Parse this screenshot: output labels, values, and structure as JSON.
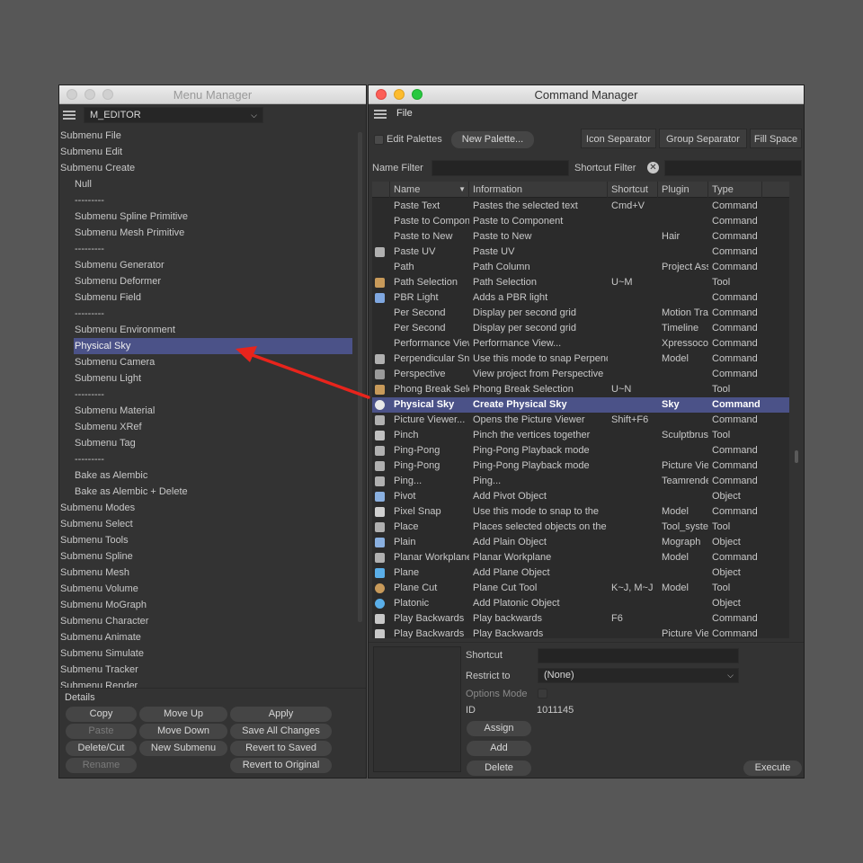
{
  "menu_manager": {
    "title": "Menu Manager",
    "menu_select": "M_EDITOR",
    "items": [
      {
        "label": "Submenu File",
        "indent": 0
      },
      {
        "label": "Submenu Edit",
        "indent": 0
      },
      {
        "label": "Submenu Create",
        "indent": 0
      },
      {
        "label": "Null",
        "indent": 1
      },
      {
        "label": "---------",
        "indent": 1
      },
      {
        "label": "Submenu Spline Primitive",
        "indent": 1
      },
      {
        "label": "Submenu Mesh Primitive",
        "indent": 1
      },
      {
        "label": "---------",
        "indent": 1
      },
      {
        "label": "Submenu Generator",
        "indent": 1
      },
      {
        "label": "Submenu Deformer",
        "indent": 1
      },
      {
        "label": "Submenu Field",
        "indent": 1
      },
      {
        "label": "---------",
        "indent": 1
      },
      {
        "label": "Submenu Environment",
        "indent": 1
      },
      {
        "label": "Physical Sky",
        "indent": 1,
        "selected": true
      },
      {
        "label": "Submenu Camera",
        "indent": 1
      },
      {
        "label": "Submenu Light",
        "indent": 1
      },
      {
        "label": "---------",
        "indent": 1
      },
      {
        "label": "Submenu Material",
        "indent": 1
      },
      {
        "label": "Submenu XRef",
        "indent": 1
      },
      {
        "label": "Submenu Tag",
        "indent": 1
      },
      {
        "label": "---------",
        "indent": 1
      },
      {
        "label": "Bake as Alembic",
        "indent": 1
      },
      {
        "label": "Bake as Alembic + Delete",
        "indent": 1
      },
      {
        "label": "Submenu Modes",
        "indent": 0
      },
      {
        "label": "Submenu Select",
        "indent": 0
      },
      {
        "label": "Submenu Tools",
        "indent": 0
      },
      {
        "label": "Submenu Spline",
        "indent": 0
      },
      {
        "label": "Submenu Mesh",
        "indent": 0
      },
      {
        "label": "Submenu Volume",
        "indent": 0
      },
      {
        "label": "Submenu MoGraph",
        "indent": 0
      },
      {
        "label": "Submenu Character",
        "indent": 0
      },
      {
        "label": "Submenu Animate",
        "indent": 0
      },
      {
        "label": "Submenu Simulate",
        "indent": 0
      },
      {
        "label": "Submenu Tracker",
        "indent": 0
      },
      {
        "label": "Submenu Render",
        "indent": 0
      }
    ],
    "details_label": "Details",
    "buttons": {
      "copy": "Copy",
      "move_up": "Move Up",
      "apply": "Apply",
      "paste": "Paste",
      "move_down": "Move Down",
      "save_all": "Save All Changes",
      "delete_cut": "Delete/Cut",
      "new_submenu": "New Submenu",
      "revert_saved": "Revert to Saved",
      "rename": "Rename",
      "revert_original": "Revert to Original"
    }
  },
  "command_manager": {
    "title": "Command Manager",
    "file_menu": "File",
    "edit_palettes": "Edit Palettes",
    "new_palette": "New Palette...",
    "icon_separator": "Icon Separator",
    "group_separator": "Group Separator",
    "fill_space": "Fill Space",
    "name_filter_label": "Name Filter",
    "name_filter_value": "",
    "shortcut_filter_label": "Shortcut Filter",
    "shortcut_filter_value": "",
    "columns": [
      "Name",
      "Information",
      "Shortcut",
      "Plugin",
      "Type"
    ],
    "rows": [
      {
        "icon": "none",
        "name": "Paste Text",
        "info": "Pastes the selected text",
        "shortcut": "Cmd+V",
        "plugin": "",
        "type": "Command"
      },
      {
        "icon": "none",
        "name": "Paste to Component",
        "info": "Paste to Component",
        "shortcut": "",
        "plugin": "",
        "type": "Command"
      },
      {
        "icon": "none",
        "name": "Paste to New",
        "info": "Paste to New",
        "shortcut": "",
        "plugin": "Hair",
        "type": "Command"
      },
      {
        "icon": "clipboard-icon",
        "name": "Paste UV",
        "info": "Paste UV",
        "shortcut": "",
        "plugin": "",
        "type": "Command"
      },
      {
        "icon": "none",
        "name": "Path",
        "info": "Path Column",
        "shortcut": "",
        "plugin": "Project Asset",
        "type": "Command"
      },
      {
        "icon": "path-selection-icon",
        "name": "Path Selection",
        "info": "Path Selection",
        "shortcut": "U~M",
        "plugin": "",
        "type": "Tool"
      },
      {
        "icon": "pbr-light-icon",
        "name": "PBR Light",
        "info": "Adds a PBR light",
        "shortcut": "",
        "plugin": "",
        "type": "Command"
      },
      {
        "icon": "none",
        "name": "Per Second",
        "info": "Display per second grid",
        "shortcut": "",
        "plugin": "Motion Tracker",
        "type": "Command"
      },
      {
        "icon": "none",
        "name": "Per Second",
        "info": "Display per second grid",
        "shortcut": "",
        "plugin": "Timeline",
        "type": "Command"
      },
      {
        "icon": "none",
        "name": "Performance View",
        "info": "Performance View...",
        "shortcut": "",
        "plugin": "Xpressocore",
        "type": "Command"
      },
      {
        "icon": "perpendicular-snap-icon",
        "name": "Perpendicular Snap",
        "info": "Use this mode to snap Perpendicular",
        "shortcut": "",
        "plugin": "Model",
        "type": "Command"
      },
      {
        "icon": "perspective-icon",
        "name": "Perspective",
        "info": "View project from Perspective",
        "shortcut": "",
        "plugin": "",
        "type": "Command"
      },
      {
        "icon": "phong-break-icon",
        "name": "Phong Break Selection",
        "info": "Phong Break Selection",
        "shortcut": "U~N",
        "plugin": "",
        "type": "Tool"
      },
      {
        "icon": "physical-sky-icon",
        "name": "Physical Sky",
        "info": "Create Physical Sky",
        "shortcut": "",
        "plugin": "Sky",
        "type": "Command",
        "selected": true
      },
      {
        "icon": "picture-viewer-icon",
        "name": "Picture Viewer...",
        "info": "Opens the Picture Viewer",
        "shortcut": "Shift+F6",
        "plugin": "",
        "type": "Command"
      },
      {
        "icon": "pinch-icon",
        "name": "Pinch",
        "info": "Pinch the vertices together",
        "shortcut": "",
        "plugin": "Sculptbrush",
        "type": "Tool"
      },
      {
        "icon": "ping-pong-icon",
        "name": "Ping-Pong",
        "info": "Ping-Pong Playback mode",
        "shortcut": "",
        "plugin": "",
        "type": "Command"
      },
      {
        "icon": "ping-pong-icon",
        "name": "Ping-Pong",
        "info": "Ping-Pong Playback mode",
        "shortcut": "",
        "plugin": "Picture Viewer",
        "type": "Command"
      },
      {
        "icon": "ping-icon",
        "name": "Ping...",
        "info": "Ping...",
        "shortcut": "",
        "plugin": "Teamrender",
        "type": "Command"
      },
      {
        "icon": "pivot-icon",
        "name": "Pivot",
        "info": "Add Pivot Object",
        "shortcut": "",
        "plugin": "",
        "type": "Object"
      },
      {
        "icon": "pixel-snap-icon",
        "name": "Pixel Snap",
        "info": "Use this mode to snap to the",
        "shortcut": "",
        "plugin": "Model",
        "type": "Command"
      },
      {
        "icon": "place-icon",
        "name": "Place",
        "info": "Places selected objects on the",
        "shortcut": "",
        "plugin": "Tool_system",
        "type": "Tool"
      },
      {
        "icon": "plain-icon",
        "name": "Plain",
        "info": "Add Plain Object",
        "shortcut": "",
        "plugin": "Mograph",
        "type": "Object"
      },
      {
        "icon": "planar-workplane-icon",
        "name": "Planar Workplane",
        "info": "Planar Workplane",
        "shortcut": "",
        "plugin": "Model",
        "type": "Command"
      },
      {
        "icon": "plane-icon",
        "name": "Plane",
        "info": "Add Plane Object",
        "shortcut": "",
        "plugin": "",
        "type": "Object"
      },
      {
        "icon": "plane-cut-icon",
        "name": "Plane Cut",
        "info": "Plane Cut Tool",
        "shortcut": "K~J, M~J",
        "plugin": "Model",
        "type": "Tool"
      },
      {
        "icon": "platonic-icon",
        "name": "Platonic",
        "info": "Add Platonic Object",
        "shortcut": "",
        "plugin": "",
        "type": "Object"
      },
      {
        "icon": "play-backwards-icon",
        "name": "Play Backwards",
        "info": "Play backwards",
        "shortcut": "F6",
        "plugin": "",
        "type": "Command"
      },
      {
        "icon": "play-backwards-icon",
        "name": "Play Backwards",
        "info": "Play Backwards",
        "shortcut": "",
        "plugin": "Picture Viewer",
        "type": "Command"
      }
    ],
    "details": {
      "shortcut_label": "Shortcut",
      "shortcut_value": "",
      "restrict_label": "Restrict to",
      "restrict_value": "(None)",
      "options_mode_label": "Options Mode",
      "id_label": "ID",
      "id_value": "1011145",
      "assign": "Assign",
      "add": "Add",
      "delete": "Delete",
      "execute": "Execute"
    }
  },
  "colors": {
    "selection": "#4b5288",
    "arrow": "#e8241c",
    "background": "#575757",
    "panel": "#333333"
  }
}
